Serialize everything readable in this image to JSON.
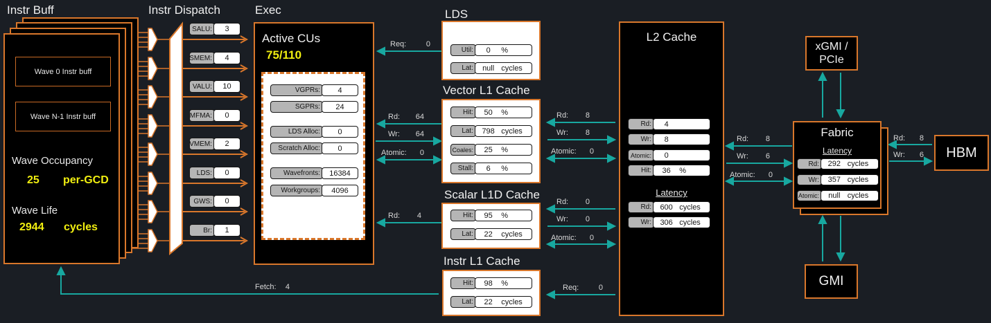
{
  "colors": {
    "background": "#1a1e24",
    "panel_black": "#000000",
    "panel_white": "#ffffff",
    "accent_orange": "#d9772b",
    "accent_teal": "#18a8a0",
    "value_yellow": "#f0ee10",
    "pill_gray": "#b5b5b5",
    "text_white": "#f0f0f0"
  },
  "instr_buff": {
    "title": "Instr Buff",
    "wave0_label": "Wave 0 Instr buff",
    "waveN_label": "Wave N-1 Instr buff",
    "occupancy_label": "Wave Occupancy",
    "occupancy_value": "25",
    "occupancy_unit": "per-GCD",
    "wave_life_label": "Wave Life",
    "wave_life_value": "2944",
    "wave_life_unit": "cycles"
  },
  "instr_dispatch": {
    "title": "Instr Dispatch",
    "rows": [
      {
        "label": "SALU:",
        "value": "3"
      },
      {
        "label": "SMEM:",
        "value": "4"
      },
      {
        "label": "VALU:",
        "value": "10"
      },
      {
        "label": "MFMA:",
        "value": "0"
      },
      {
        "label": "VMEM:",
        "value": "2"
      },
      {
        "label": "LDS:",
        "value": "0"
      },
      {
        "label": "GWS:",
        "value": "0"
      },
      {
        "label": "Br:",
        "value": "1"
      }
    ]
  },
  "exec": {
    "title": "Exec",
    "active_cus_label": "Active CUs",
    "active_cus_value": "75/110",
    "rows": [
      {
        "label": "VGPRs:",
        "value": "4"
      },
      {
        "label": "SGPRs:",
        "value": "24"
      },
      {
        "label": "LDS Alloc:",
        "value": "0"
      },
      {
        "label": "Scratch Alloc:",
        "value": "0"
      },
      {
        "label": "Wavefronts:",
        "value": "16384"
      },
      {
        "label": "Workgroups:",
        "value": "4096"
      }
    ]
  },
  "lds": {
    "title": "LDS",
    "rows": [
      {
        "label": "Util:",
        "value": "0",
        "unit": "%"
      },
      {
        "label": "Lat:",
        "value": "null",
        "unit": "cycles"
      }
    ]
  },
  "vector_l1": {
    "title": "Vector L1 Cache",
    "rows": [
      {
        "label": "Hit:",
        "value": "50",
        "unit": "%"
      },
      {
        "label": "Lat:",
        "value": "798",
        "unit": "cycles"
      },
      {
        "label": "Coales:",
        "value": "25",
        "unit": "%"
      },
      {
        "label": "Stall:",
        "value": "6",
        "unit": "%"
      }
    ]
  },
  "scalar_l1d": {
    "title": "Scalar L1D Cache",
    "rows": [
      {
        "label": "Hit:",
        "value": "95",
        "unit": "%"
      },
      {
        "label": "Lat:",
        "value": "22",
        "unit": "cycles"
      }
    ]
  },
  "instr_l1": {
    "title": "Instr L1 Cache",
    "rows": [
      {
        "label": "Hit:",
        "value": "98",
        "unit": "%"
      },
      {
        "label": "Lat:",
        "value": "22",
        "unit": "cycles"
      }
    ]
  },
  "l2_cache": {
    "title": "L2 Cache",
    "rows": [
      {
        "label": "Rd:",
        "value": "4",
        "unit": ""
      },
      {
        "label": "Wr:",
        "value": "8",
        "unit": ""
      },
      {
        "label": "Atomic:",
        "value": "0",
        "unit": ""
      },
      {
        "label": "Hit:",
        "value": "36",
        "unit": "%"
      }
    ],
    "latency_heading": "Latency",
    "latency_rows": [
      {
        "label": "Rd:",
        "value": "600",
        "unit": "cycles"
      },
      {
        "label": "Wr:",
        "value": "306",
        "unit": "cycles"
      }
    ]
  },
  "fabric": {
    "title": "Fabric",
    "latency_heading": "Latency",
    "rows": [
      {
        "label": "Rd:",
        "value": "292",
        "unit": "cycles"
      },
      {
        "label": "Wr:",
        "value": "357",
        "unit": "cycles"
      },
      {
        "label": "Atomic:",
        "value": "null",
        "unit": "cycles"
      }
    ]
  },
  "memory": {
    "xgmi_line1": "xGMI /",
    "xgmi_line2": "PCIe",
    "hbm": "HBM",
    "gmi": "GMI"
  },
  "edges": {
    "exec_lds_req": {
      "label": "Req:",
      "value": "0"
    },
    "exec_vl1_rd": {
      "label": "Rd:",
      "value": "64"
    },
    "exec_vl1_wr": {
      "label": "Wr:",
      "value": "64"
    },
    "exec_vl1_atomic": {
      "label": "Atomic:",
      "value": "0"
    },
    "exec_sl1_rd": {
      "label": "Rd:",
      "value": "4"
    },
    "fetch": {
      "label": "Fetch:",
      "value": "4"
    },
    "vl1_l2_rd": {
      "label": "Rd:",
      "value": "8"
    },
    "vl1_l2_wr": {
      "label": "Wr:",
      "value": "8"
    },
    "vl1_l2_atomic": {
      "label": "Atomic:",
      "value": "0"
    },
    "sl1_l2_rd": {
      "label": "Rd:",
      "value": "0"
    },
    "sl1_l2_wr": {
      "label": "Wr:",
      "value": "0"
    },
    "sl1_l2_atomic": {
      "label": "Atomic:",
      "value": "0"
    },
    "il1_l2_req": {
      "label": "Req:",
      "value": "0"
    },
    "l2_fabric_rd": {
      "label": "Rd:",
      "value": "8"
    },
    "l2_fabric_wr": {
      "label": "Wr:",
      "value": "6"
    },
    "l2_fabric_atomic": {
      "label": "Atomic:",
      "value": "0"
    },
    "fabric_hbm_rd": {
      "label": "Rd:",
      "value": "8"
    },
    "fabric_hbm_wr": {
      "label": "Wr:",
      "value": "6"
    }
  }
}
